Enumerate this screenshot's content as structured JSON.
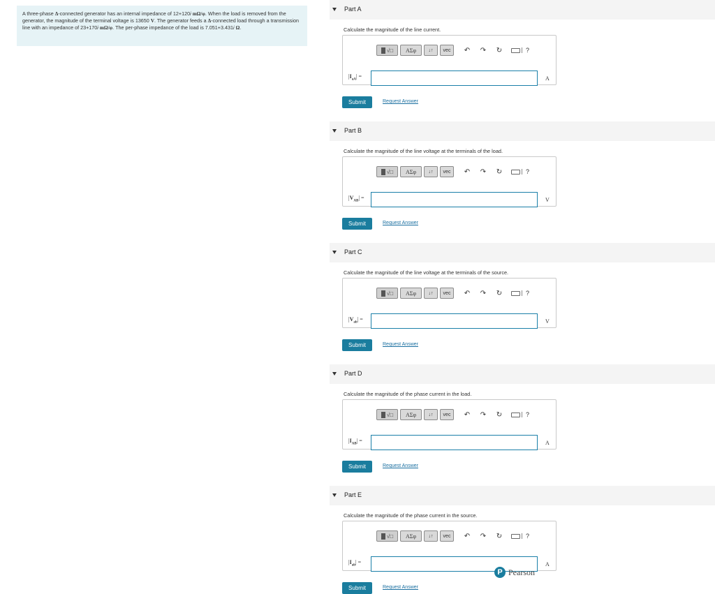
{
  "problem": {
    "text_1": "A three-phase ",
    "delta_1": "Δ",
    "text_2": "-connected generator has an internal impedance of 12+120",
    "i_1": "i",
    "unit_mohm_1": "mΩ/φ",
    "text_3": ". When the load is removed from the generator, the magnitude of the terminal voltage is 13650 ",
    "unit_v": "V",
    "text_4": ". The generator feeds a ",
    "delta_2": "Δ",
    "text_5": "-connected load through a transmission line with an impedance of 23+170",
    "i_2": "i",
    "unit_mohm_2": "mΩ/φ",
    "text_6": ". The per-phase impedance of the load is 7.051+3.431",
    "i_3": "i",
    "unit_ohm": "Ω",
    "text_7": "."
  },
  "toolbar": {
    "greek_label": "ΑΣφ",
    "arrows_label": "↓↑",
    "vec_label": "vec",
    "undo_icon": "↶",
    "redo_icon": "↷",
    "reset_icon": "↻",
    "help_label": "?"
  },
  "parts": [
    {
      "title": "Part A",
      "question": "Calculate the magnitude of the line current.",
      "var_main": "I",
      "var_sub": "aA",
      "unit": "A",
      "submit": "Submit",
      "request": "Request Answer"
    },
    {
      "title": "Part B",
      "question": "Calculate the magnitude of the line voltage at the terminals of the load.",
      "var_main": "V",
      "var_sub": "AB",
      "unit": "V",
      "submit": "Submit",
      "request": "Request Answer"
    },
    {
      "title": "Part C",
      "question": "Calculate the magnitude of the line voltage at the terminals of the source.",
      "var_main": "V",
      "var_sub": "ab",
      "unit": "V",
      "submit": "Submit",
      "request": "Request Answer"
    },
    {
      "title": "Part D",
      "question": "Calculate the magnitude of the phase current in the load.",
      "var_main": "I",
      "var_sub": "AB",
      "unit": "A",
      "submit": "Submit",
      "request": "Request Answer"
    },
    {
      "title": "Part E",
      "question": "Calculate the magnitude of the phase current in the source.",
      "var_main": "I",
      "var_sub": "ab",
      "unit": "A",
      "submit": "Submit",
      "request": "Request Answer"
    }
  ],
  "brand": {
    "logo_letter": "P",
    "name": "Pearson"
  }
}
